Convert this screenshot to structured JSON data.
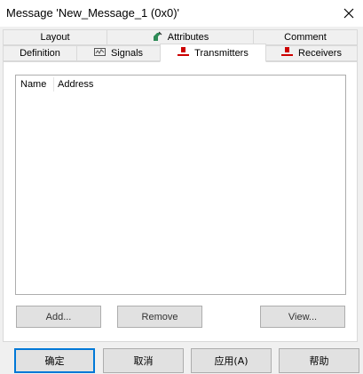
{
  "window": {
    "title": "Message 'New_Message_1 (0x0)'"
  },
  "tabs": {
    "row1": [
      {
        "label": "Layout"
      },
      {
        "label": "Attributes",
        "icon": "attributes-icon"
      },
      {
        "label": "Comment"
      }
    ],
    "row2": [
      {
        "label": "Definition"
      },
      {
        "label": "Signals",
        "icon": "signals-icon"
      },
      {
        "label": "Transmitters",
        "icon": "transmitter-icon"
      },
      {
        "label": "Receivers",
        "icon": "receiver-icon"
      }
    ],
    "active": "Transmitters"
  },
  "list": {
    "columns": [
      "Name",
      "Address"
    ],
    "rows": []
  },
  "panel_buttons": {
    "add": "Add...",
    "remove": "Remove",
    "view": "View..."
  },
  "dialog_buttons": {
    "ok": "确定",
    "cancel": "取消",
    "apply": "应用(A)",
    "help": "帮助"
  },
  "colors": {
    "accent": "#0078d7",
    "node_red": "#cc0000",
    "attr_green": "#2e8b57"
  }
}
